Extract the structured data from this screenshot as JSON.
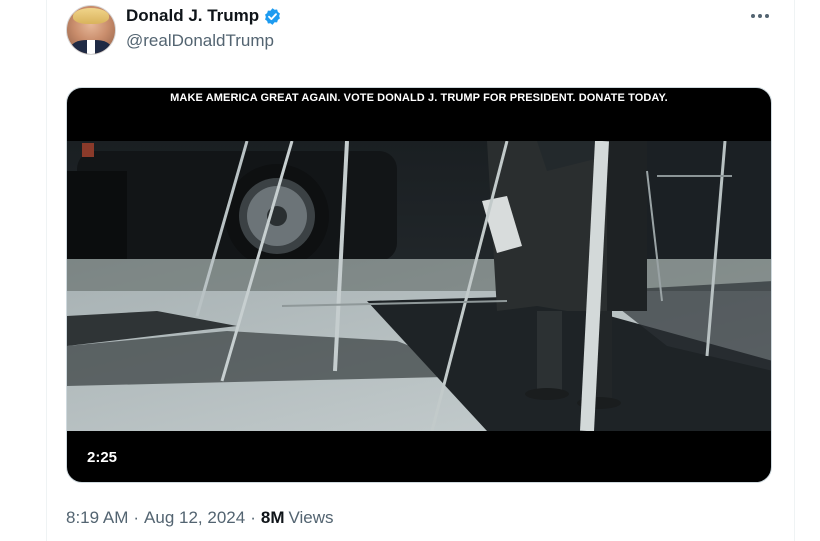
{
  "tweet": {
    "display_name": "Donald J. Trump",
    "handle": "@realDonaldTrump",
    "verified_icon": "verified-badge-icon",
    "more_icon": "more-options-icon",
    "video": {
      "caption": "MAKE AMERICA GREAT AGAIN. VOTE DONALD J. TRUMP FOR PRESIDENT. DONATE TODAY.",
      "duration": "2:25"
    },
    "meta": {
      "time": "8:19 AM",
      "separator": "·",
      "date": "Aug 12, 2024",
      "views_count": "8M",
      "views_label": "Views"
    }
  },
  "colors": {
    "verified_blue": "#1d9bf0",
    "secondary_text": "#536471",
    "primary_text": "#0f1419"
  }
}
